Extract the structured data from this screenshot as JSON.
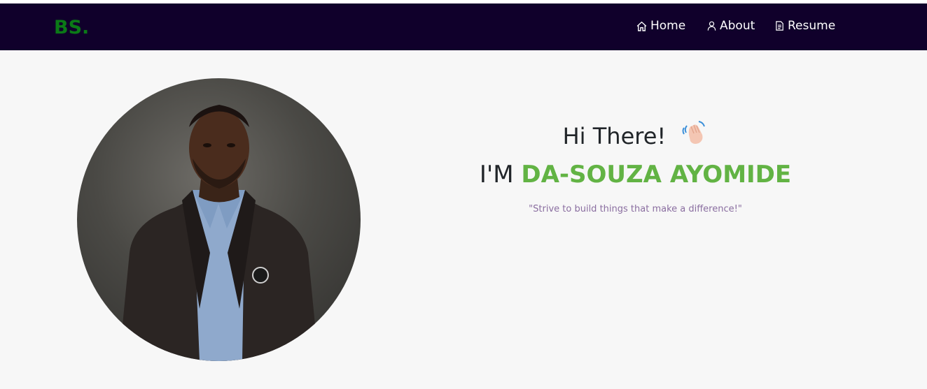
{
  "header": {
    "brand": "BS.",
    "nav": [
      {
        "label": "Home",
        "icon": "home-icon"
      },
      {
        "label": "About",
        "icon": "user-icon"
      },
      {
        "label": "Resume",
        "icon": "document-icon"
      }
    ]
  },
  "hero": {
    "greeting": "Hi There!",
    "wave_icon": "waving-hand-icon",
    "intro_prefix": "I'M",
    "name": "DA-SOUZA AYOMIDE",
    "quote": "\"Strive to build things that make a difference!\""
  },
  "colors": {
    "navbar_bg": "#10002b",
    "brand": "#0b7a17",
    "name_accent": "#62b344",
    "quote": "#8a6ea0",
    "page_bg": "#f7f7f7"
  }
}
